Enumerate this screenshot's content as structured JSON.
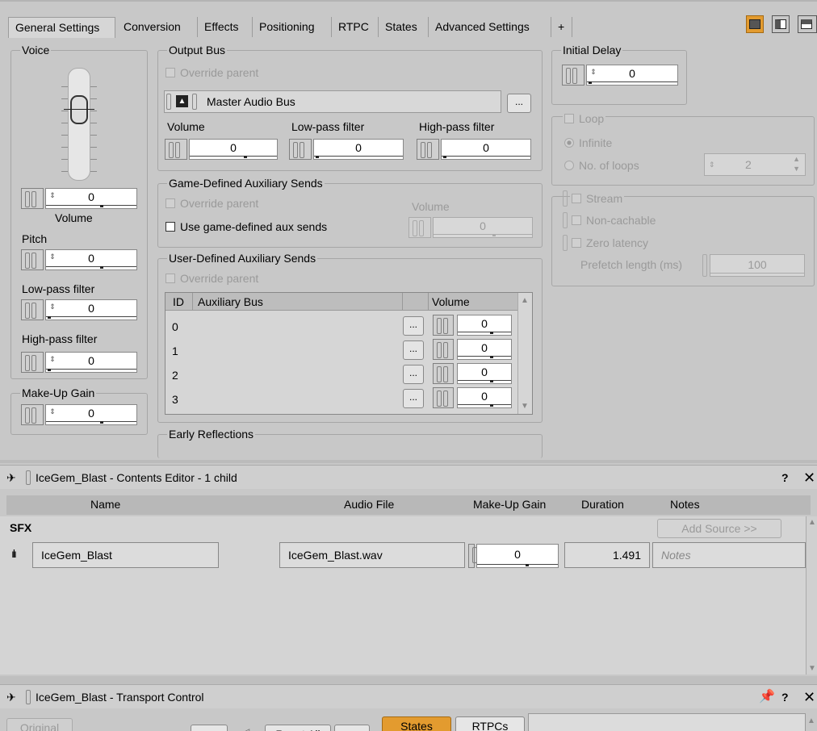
{
  "tabs": [
    "General Settings",
    "Conversion",
    "Effects",
    "Positioning",
    "RTPC",
    "States",
    "Advanced Settings",
    "+"
  ],
  "voice": {
    "title": "Voice",
    "volume_value": "0",
    "volume_label": "Volume",
    "pitch_label": "Pitch",
    "pitch_value": "0",
    "lowpass_label": "Low-pass filter",
    "lowpass_value": "0",
    "highpass_label": "High-pass filter",
    "highpass_value": "0"
  },
  "makeup": {
    "title": "Make-Up Gain",
    "value": "0"
  },
  "output_bus": {
    "title": "Output Bus",
    "override_label": "Override parent",
    "bus_name": "Master Audio Bus",
    "browse_label": "...",
    "volume_label": "Volume",
    "volume_value": "0",
    "lowpass_label": "Low-pass filter",
    "lowpass_value": "0",
    "highpass_label": "High-pass filter",
    "highpass_value": "0"
  },
  "game_aux": {
    "title": "Game-Defined Auxiliary Sends",
    "override_label": "Override parent",
    "use_label": "Use game-defined aux sends",
    "volume_label": "Volume",
    "volume_value": "0"
  },
  "user_aux": {
    "title": "User-Defined Auxiliary Sends",
    "override_label": "Override parent",
    "col_id": "ID",
    "col_bus": "Auxiliary Bus",
    "col_volume": "Volume",
    "rows": [
      {
        "id": "0",
        "volume": "0"
      },
      {
        "id": "1",
        "volume": "0"
      },
      {
        "id": "2",
        "volume": "0"
      },
      {
        "id": "3",
        "volume": "0"
      }
    ],
    "browse_label": "..."
  },
  "early_reflections": {
    "title": "Early Reflections"
  },
  "initial_delay": {
    "title": "Initial Delay",
    "value": "0"
  },
  "loop": {
    "label": "Loop",
    "infinite_label": "Infinite",
    "loops_label": "No. of loops",
    "loops_value": "2"
  },
  "stream": {
    "stream_label": "Stream",
    "noncachable_label": "Non-cachable",
    "zerolatency_label": "Zero latency",
    "prefetch_label": "Prefetch length (ms)",
    "prefetch_value": "100"
  },
  "contents_editor": {
    "title": "IceGem_Blast - Contents Editor - 1 child",
    "cols": {
      "name": "Name",
      "audio_file": "Audio File",
      "makeup_gain": "Make-Up Gain",
      "duration": "Duration",
      "notes": "Notes"
    },
    "group_label": "SFX",
    "add_source_label": "Add Source >>",
    "row": {
      "name": "IceGem_Blast",
      "file": "IceGem_Blast.wav",
      "makeup": "0",
      "duration": "1.491",
      "notes_placeholder": "Notes"
    }
  },
  "transport": {
    "title": "IceGem_Blast - Transport Control",
    "original_label": "Original",
    "reset_label": "Reset All",
    "more_label": ">>",
    "states_label": "States",
    "rtpcs_label": "RTPCs"
  },
  "colors": {
    "accent": "#e39b2f",
    "panel_bg": "#c8c8c8"
  }
}
